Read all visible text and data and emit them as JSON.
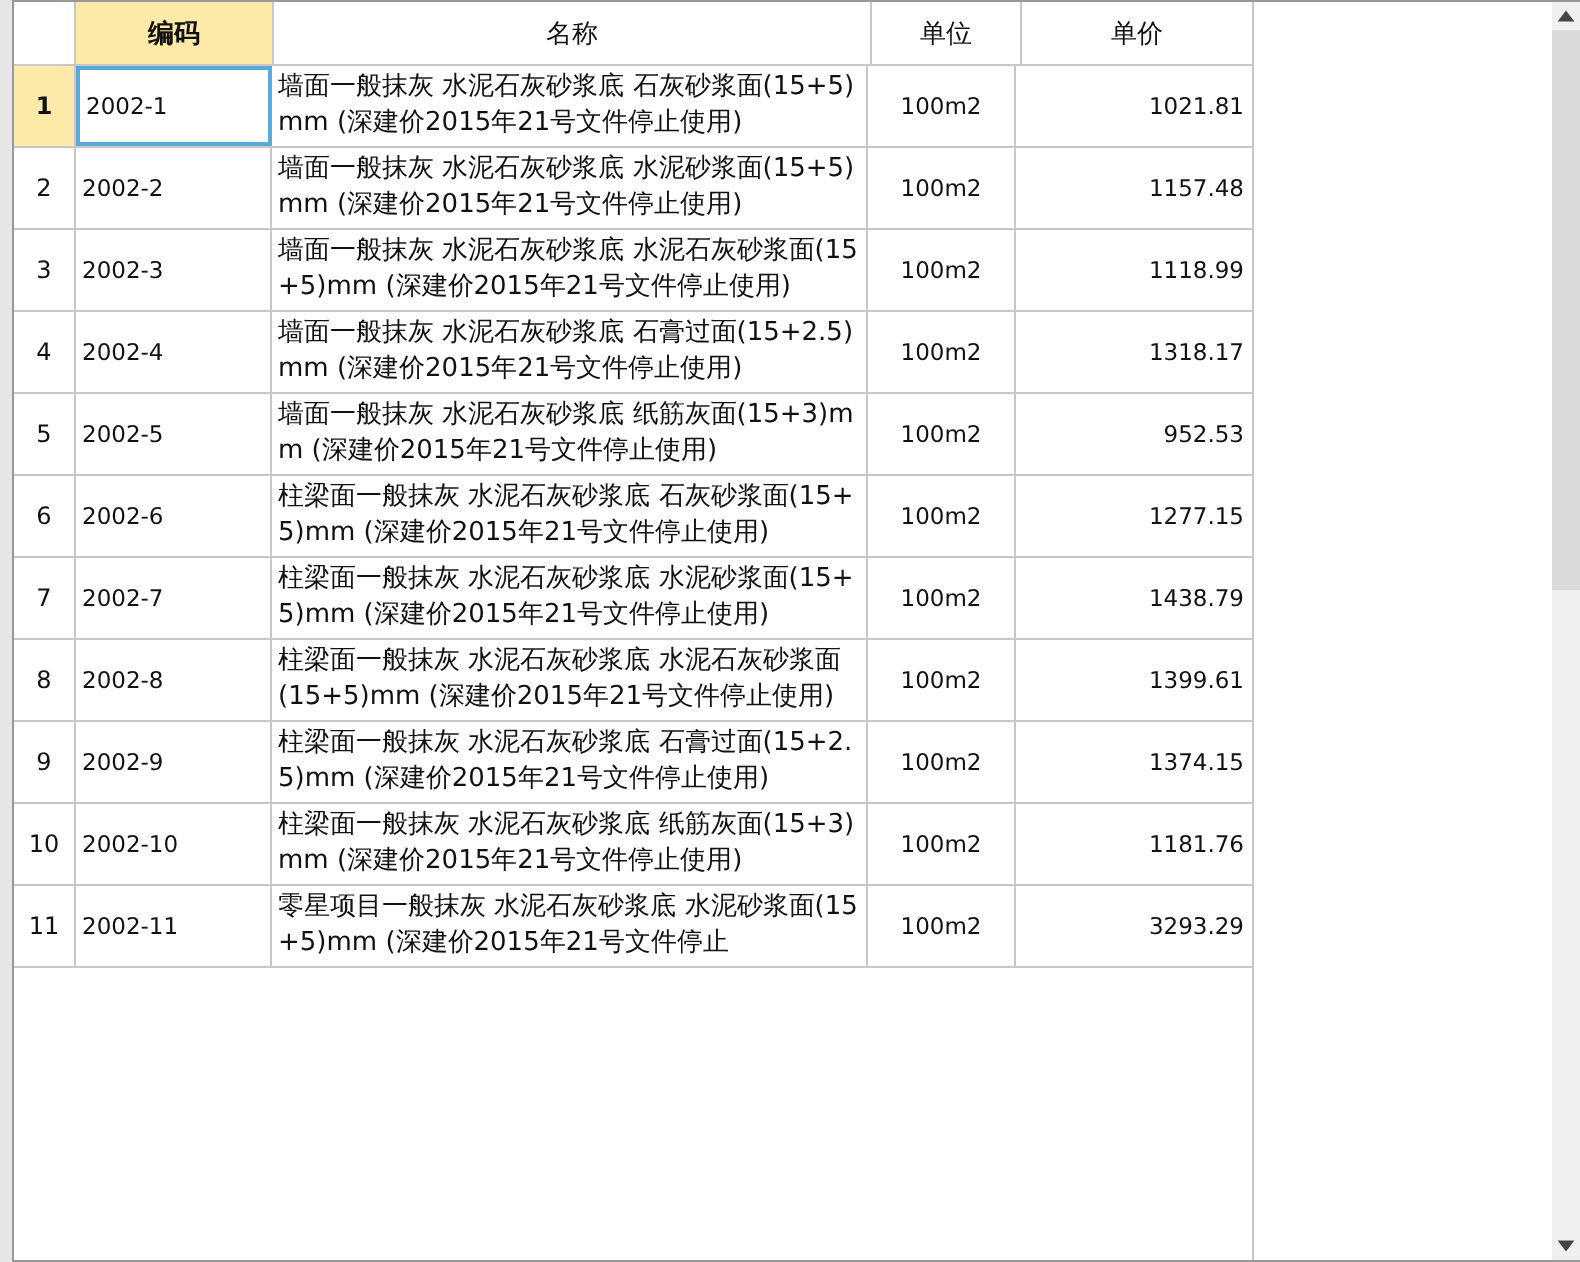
{
  "columns": [
    {
      "label": "编码",
      "selected": true
    },
    {
      "label": "名称",
      "selected": false
    },
    {
      "label": "单位",
      "selected": false
    },
    {
      "label": "单价",
      "selected": false
    }
  ],
  "rows": [
    {
      "index": "1",
      "code": "2002-1",
      "name": "墙面一般抹灰 水泥石灰砂浆底 石灰砂浆面(15+5)mm (深建价2015年21号文件停止使用)",
      "unit": "100m2",
      "price": "1021.81",
      "selected": true
    },
    {
      "index": "2",
      "code": "2002-2",
      "name": "墙面一般抹灰 水泥石灰砂浆底 水泥砂浆面(15+5)mm (深建价2015年21号文件停止使用)",
      "unit": "100m2",
      "price": "1157.48",
      "selected": false
    },
    {
      "index": "3",
      "code": "2002-3",
      "name": "墙面一般抹灰 水泥石灰砂浆底 水泥石灰砂浆面(15+5)mm (深建价2015年21号文件停止使用)",
      "unit": "100m2",
      "price": "1118.99",
      "selected": false
    },
    {
      "index": "4",
      "code": "2002-4",
      "name": "墙面一般抹灰 水泥石灰砂浆底 石膏过面(15+2.5)mm (深建价2015年21号文件停止使用)",
      "unit": "100m2",
      "price": "1318.17",
      "selected": false
    },
    {
      "index": "5",
      "code": "2002-5",
      "name": "墙面一般抹灰 水泥石灰砂浆底 纸筋灰面(15+3)mm (深建价2015年21号文件停止使用)",
      "unit": "100m2",
      "price": "952.53",
      "selected": false
    },
    {
      "index": "6",
      "code": "2002-6",
      "name": "柱梁面一般抹灰 水泥石灰砂浆底 石灰砂浆面(15+5)mm (深建价2015年21号文件停止使用)",
      "unit": "100m2",
      "price": "1277.15",
      "selected": false
    },
    {
      "index": "7",
      "code": "2002-7",
      "name": "柱梁面一般抹灰 水泥石灰砂浆底 水泥砂浆面(15+5)mm (深建价2015年21号文件停止使用)",
      "unit": "100m2",
      "price": "1438.79",
      "selected": false
    },
    {
      "index": "8",
      "code": "2002-8",
      "name": "柱梁面一般抹灰 水泥石灰砂浆底 水泥石灰砂浆面(15+5)mm (深建价2015年21号文件停止使用)",
      "unit": "100m2",
      "price": "1399.61",
      "selected": false
    },
    {
      "index": "9",
      "code": "2002-9",
      "name": "柱梁面一般抹灰 水泥石灰砂浆底 石膏过面(15+2.5)mm (深建价2015年21号文件停止使用)",
      "unit": "100m2",
      "price": "1374.15",
      "selected": false
    },
    {
      "index": "10",
      "code": "2002-10",
      "name": "柱梁面一般抹灰 水泥石灰砂浆底 纸筋灰面(15+3)mm (深建价2015年21号文件停止使用)",
      "unit": "100m2",
      "price": "1181.76",
      "selected": false
    },
    {
      "index": "11",
      "code": "2002-11",
      "name": "零星项目一般抹灰 水泥石灰砂浆底 水泥砂浆面(15+5)mm (深建价2015年21号文件停止",
      "unit": "100m2",
      "price": "3293.29",
      "selected": false
    }
  ]
}
